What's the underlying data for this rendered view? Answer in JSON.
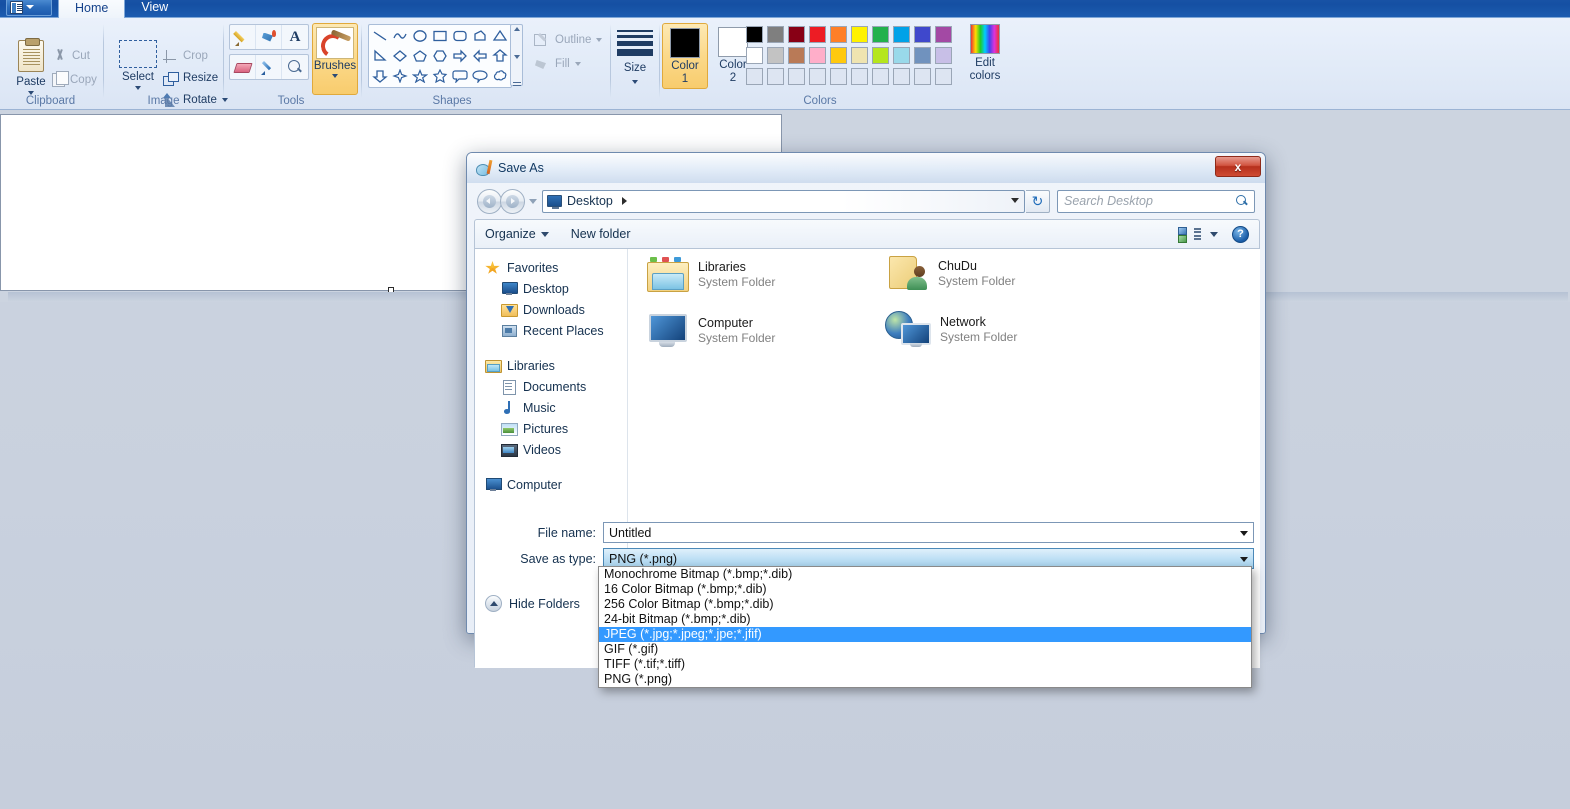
{
  "paint": {
    "quick_access": {
      "menu_label": "paint-menu"
    },
    "tabs": [
      {
        "label": "Home",
        "active": true
      },
      {
        "label": "View",
        "active": false
      }
    ],
    "groups": {
      "clipboard": {
        "label": "Clipboard",
        "paste": "Paste",
        "cut": "Cut",
        "copy": "Copy"
      },
      "image": {
        "label": "Image",
        "select": "Select",
        "crop": "Crop",
        "resize": "Resize",
        "rotate": "Rotate"
      },
      "tools": {
        "label": "Tools",
        "brushes": "Brushes",
        "items": [
          "pencil-icon",
          "fill-icon",
          "text-icon",
          "eraser-icon",
          "color-picker-icon",
          "magnifier-icon"
        ]
      },
      "shapes": {
        "label": "Shapes",
        "outline": "Outline",
        "fill": "Fill",
        "size": "Size"
      },
      "colors": {
        "label": "Colors",
        "color1": "Color\n1",
        "color1_line1": "Color",
        "color1_line2": "1",
        "color2_line1": "Color",
        "color2_line2": "2",
        "edit_line1": "Edit",
        "edit_line2": "colors",
        "color1_value": "#000000",
        "color2_value": "#ffffff",
        "row1": [
          "#000000",
          "#7f7f7f",
          "#880015",
          "#ed1c24",
          "#ff7f27",
          "#fff200",
          "#22b14c",
          "#00a2e8",
          "#3f48cc",
          "#a349a4"
        ],
        "row2": [
          "#ffffff",
          "#c3c3c3",
          "#b97a57",
          "#ffaec9",
          "#ffc90e",
          "#efe4b0",
          "#b5e61d",
          "#99d9ea",
          "#7092be",
          "#c8bfe7"
        ],
        "row3": [
          "#dde5f2",
          "#dde5f2",
          "#dde5f2",
          "#dde5f2",
          "#dde5f2",
          "#dde5f2",
          "#dde5f2",
          "#dde5f2",
          "#dde5f2",
          "#dde5f2"
        ]
      }
    }
  },
  "dialog": {
    "title": "Save As",
    "close_label": "x",
    "address": {
      "path_label": "Desktop",
      "search_placeholder": "Search Desktop"
    },
    "commandbar": {
      "organize": "Organize",
      "new_folder": "New folder",
      "help_label": "?"
    },
    "navpane": [
      {
        "label": "Favorites",
        "icon": "favorites-star-icon",
        "type": "header"
      },
      {
        "label": "Desktop",
        "icon": "desktop-icon",
        "type": "child"
      },
      {
        "label": "Downloads",
        "icon": "downloads-folder-icon",
        "type": "child"
      },
      {
        "label": "Recent Places",
        "icon": "recent-places-icon",
        "type": "child"
      },
      {
        "label": "Libraries",
        "icon": "libraries-icon",
        "type": "header"
      },
      {
        "label": "Documents",
        "icon": "documents-icon",
        "type": "child"
      },
      {
        "label": "Music",
        "icon": "music-icon",
        "type": "child"
      },
      {
        "label": "Pictures",
        "icon": "pictures-icon",
        "type": "child"
      },
      {
        "label": "Videos",
        "icon": "videos-icon",
        "type": "child"
      },
      {
        "label": "Computer",
        "icon": "computer-icon",
        "type": "header"
      }
    ],
    "files": [
      {
        "name": "Libraries",
        "subtitle": "System Folder",
        "icon": "libraries-folder-icon"
      },
      {
        "name": "ChuDu",
        "subtitle": "System Folder",
        "icon": "user-folder-icon"
      },
      {
        "name": "Computer",
        "subtitle": "System Folder",
        "icon": "computer-icon"
      },
      {
        "name": "Network",
        "subtitle": "System Folder",
        "icon": "network-icon"
      }
    ],
    "form": {
      "file_name_label": "File name:",
      "file_name_value": "Untitled",
      "save_as_type_label": "Save as type:",
      "save_as_type_value": "PNG (*.png)",
      "hide_folders": "Hide Folders"
    },
    "type_options": [
      {
        "label": "Monochrome Bitmap (*.bmp;*.dib)",
        "selected": false
      },
      {
        "label": "16 Color Bitmap (*.bmp;*.dib)",
        "selected": false
      },
      {
        "label": "256 Color Bitmap (*.bmp;*.dib)",
        "selected": false
      },
      {
        "label": "24-bit Bitmap (*.bmp;*.dib)",
        "selected": false
      },
      {
        "label": "JPEG (*.jpg;*.jpeg;*.jpe;*.jfif)",
        "selected": true
      },
      {
        "label": "GIF (*.gif)",
        "selected": false
      },
      {
        "label": "TIFF (*.tif;*.tiff)",
        "selected": false
      },
      {
        "label": "PNG (*.png)",
        "selected": false
      }
    ]
  }
}
